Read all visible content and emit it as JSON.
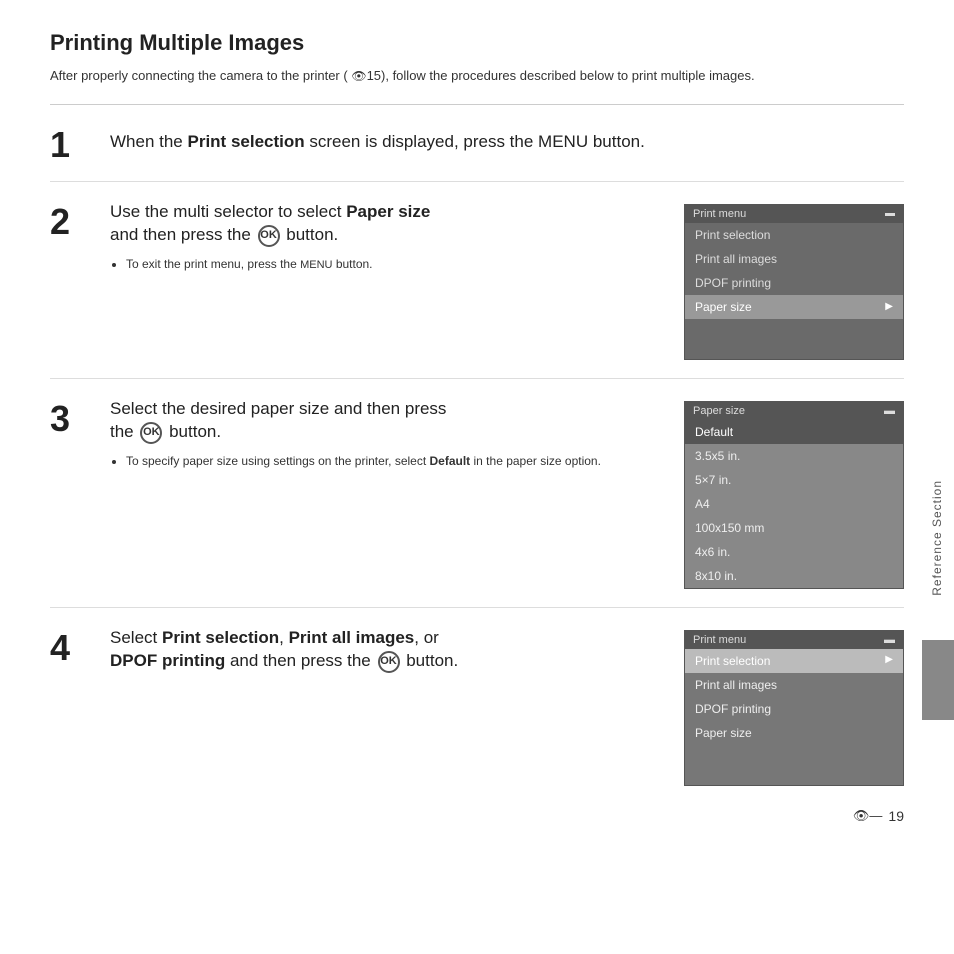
{
  "page": {
    "title": "Printing Multiple Images",
    "intro": "After properly connecting the camera to the printer (⚙15), follow the procedures described below to print multiple images."
  },
  "steps": [
    {
      "number": "1",
      "text_plain": "When the ",
      "text_bold": "Print selection",
      "text_after": " screen is displayed, press the ",
      "text_menu": "MENU",
      "text_end": " button."
    },
    {
      "number": "2",
      "text_plain": "Use the multi selector to select ",
      "text_bold": "Paper size",
      "text_after": "\nand then press the",
      "text_btn": "OK",
      "text_end": " button.",
      "bullet": "To exit the print menu, press the MENU button.",
      "menu": {
        "title": "Print menu",
        "items": [
          "Print selection",
          "Print all images",
          "DPOF printing",
          "Paper size"
        ],
        "selected": "Paper size"
      }
    },
    {
      "number": "3",
      "text_plain": "Select the desired paper size and then press the",
      "text_btn": "OK",
      "text_end": " button.",
      "bullet": "To specify paper size using settings on the printer, select Default in the paper size option.",
      "menu": {
        "title": "Paper size",
        "items": [
          "Default",
          "3.5x5 in.",
          "5×7 in.",
          "A4",
          "100x150 mm",
          "4x6 in.",
          "8x10 in."
        ],
        "selected": "Default"
      }
    },
    {
      "number": "4",
      "text_plain": "Select ",
      "text_bold1": "Print selection",
      "text_comma": ", ",
      "text_bold2": "Print all images",
      "text_or": ", or\n",
      "text_bold3": "DPOF printing",
      "text_after": " and then press the",
      "text_btn": "OK",
      "text_end": " button.",
      "menu": {
        "title": "Print menu",
        "items": [
          "Print selection",
          "Print all images",
          "DPOF printing",
          "Paper size"
        ],
        "selected": "Print selection"
      }
    }
  ],
  "sidebar": {
    "label": "Reference Section"
  },
  "footer": {
    "icon": "🔭",
    "page_number": "19"
  }
}
